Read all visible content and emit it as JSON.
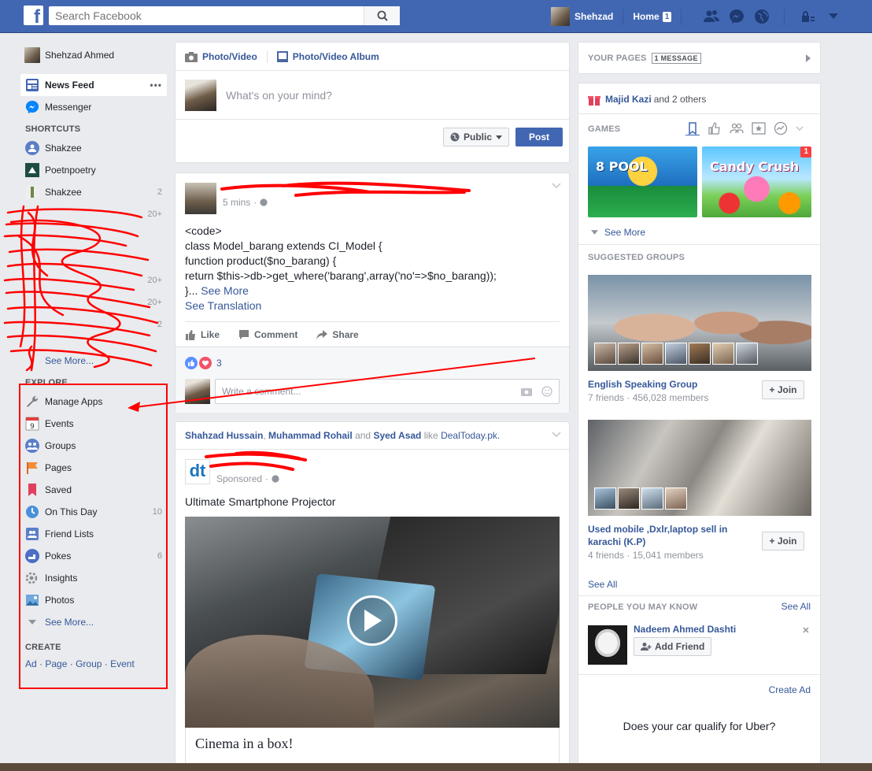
{
  "topbar": {
    "search_placeholder": "Search Facebook",
    "user_name": "Shehzad",
    "home_label": "Home",
    "home_count": "1"
  },
  "left": {
    "profile_name": "Shehzad Ahmed",
    "news_feed": "News Feed",
    "news_feed_more": "•••",
    "messenger": "Messenger",
    "shortcuts_title": "SHORTCUTS",
    "shortcuts": [
      {
        "label": "Shakzee",
        "count": ""
      },
      {
        "label": "Poetnpoetry",
        "count": ""
      },
      {
        "label": "Shakzee",
        "count": "2"
      },
      {
        "label": "",
        "count": "20+"
      },
      {
        "label": "",
        "count": ""
      },
      {
        "label": "",
        "count": ""
      },
      {
        "label": "",
        "count": "20+"
      },
      {
        "label": "",
        "count": "20+"
      },
      {
        "label": "",
        "count": "2"
      },
      {
        "label": "",
        "count": ""
      }
    ],
    "shortcuts_see_more": "See More...",
    "explore_title": "EXPLORE",
    "explore": [
      {
        "label": "Manage Apps",
        "count": "",
        "icon": "wrench-icon"
      },
      {
        "label": "Events",
        "count": "",
        "icon": "calendar-icon"
      },
      {
        "label": "Groups",
        "count": "",
        "icon": "groups-icon"
      },
      {
        "label": "Pages",
        "count": "",
        "icon": "flag-icon"
      },
      {
        "label": "Saved",
        "count": "",
        "icon": "bookmark-icon"
      },
      {
        "label": "On This Day",
        "count": "10",
        "icon": "clock-icon"
      },
      {
        "label": "Friend Lists",
        "count": "",
        "icon": "friend-list-icon"
      },
      {
        "label": "Pokes",
        "count": "6",
        "icon": "poke-icon"
      },
      {
        "label": "Insights",
        "count": "",
        "icon": "insights-icon"
      },
      {
        "label": "Photos",
        "count": "",
        "icon": "photos-icon"
      }
    ],
    "explore_see_more": "See More...",
    "create_title": "CREATE",
    "create_links": [
      "Ad",
      "Page",
      "Group",
      "Event"
    ],
    "calendar_day": "9"
  },
  "composer": {
    "tab_photo": "Photo/Video",
    "tab_album": "Photo/Video Album",
    "placeholder": "What's on your mind?",
    "privacy": "Public",
    "post": "Post"
  },
  "post1": {
    "time": "5 mins",
    "lines": [
      "<code>",
      "class Model_barang extends CI_Model {",
      "function product($no_barang) {",
      "return $this->db->get_where('barang',array('no'=>$no_barang));"
    ],
    "last_line_prefix": "}...",
    "see_more": "See More",
    "see_translation": "See Translation",
    "like": "Like",
    "comment": "Comment",
    "share": "Share",
    "reaction_count": "3",
    "comment_placeholder": "Write a comment..."
  },
  "post2": {
    "friend1": "Shahzad Hussain",
    "sep1": ",",
    "friend2": "Muhammad Rohail",
    "and_word": "and",
    "friend3": "Syed Asad",
    "like_word": "like",
    "page": "DealToday.pk.",
    "logo": "dt",
    "sponsored": "Sponsored",
    "title": "Ultimate Smartphone Projector",
    "caption": "Cinema in a box!"
  },
  "right": {
    "your_pages": "YOUR PAGES",
    "message_badge": "1 MESSAGE",
    "friend_name": "Majid Kazi",
    "friend_others": "and 2 others",
    "games_title": "GAMES",
    "game1": "8 POOL",
    "game2": "Candy Crush",
    "game2_badge": "1",
    "see_more": "See More",
    "suggested_title": "SUGGESTED GROUPS",
    "group1_name": "English Speaking Group",
    "group1_meta": "7 friends · 456,028 members",
    "group2_name": "Used mobile ,Dxlr,laptop sell in karachi (K.P)",
    "group2_meta": "4 friends · 15,041 members",
    "join": "+ Join",
    "see_all": "See All",
    "pymk_title": "PEOPLE YOU MAY KNOW",
    "pymk_see_all": "See All",
    "pymk_name": "Nadeem Ahmed Dashti",
    "add_friend": "Add Friend",
    "create_ad": "Create Ad",
    "uber": "Does your car qualify for Uber?"
  },
  "colors": {
    "brand": "#4267b2",
    "link": "#365899",
    "annotation": "#ff0000"
  }
}
